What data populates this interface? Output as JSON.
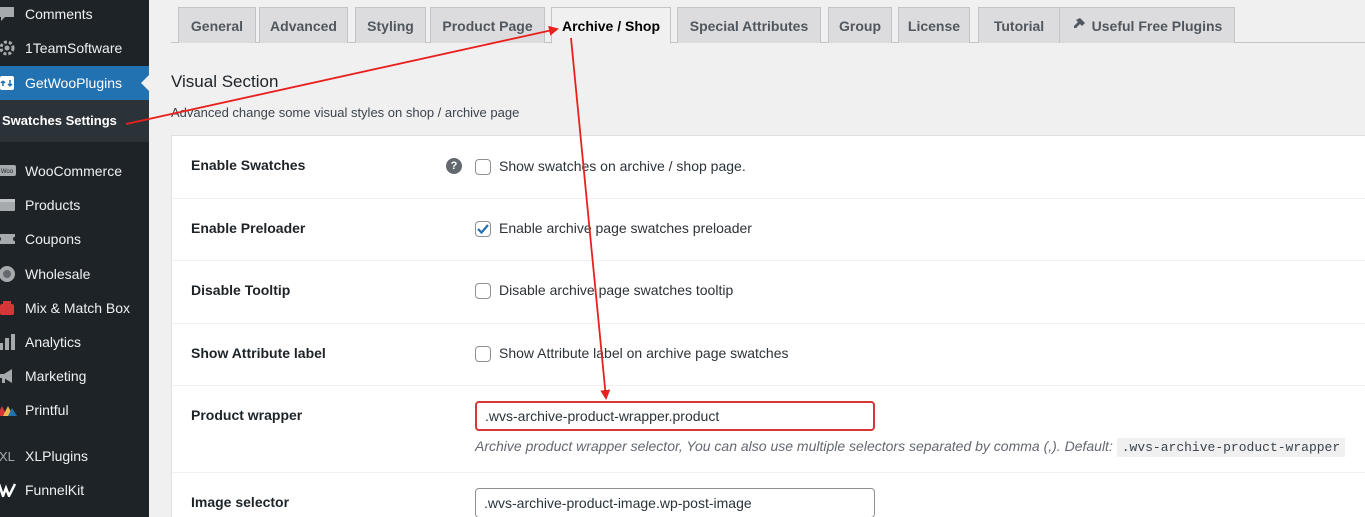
{
  "sidebar": {
    "items": [
      {
        "label": "Comments",
        "icon": "comments-icon"
      },
      {
        "label": "1TeamSoftware",
        "icon": "gear-icon"
      },
      {
        "label": "GetWooPlugins",
        "icon": "plugin-icon"
      },
      {
        "label": "WooCommerce",
        "icon": "woo-icon"
      },
      {
        "label": "Products",
        "icon": "products-icon"
      },
      {
        "label": "Coupons",
        "icon": "coupon-icon"
      },
      {
        "label": "Wholesale",
        "icon": "wholesale-icon"
      },
      {
        "label": "Mix & Match Box",
        "icon": "box-icon"
      },
      {
        "label": "Analytics",
        "icon": "analytics-icon"
      },
      {
        "label": "Marketing",
        "icon": "megaphone-icon"
      },
      {
        "label": "Printful",
        "icon": "printful-icon"
      },
      {
        "label": "XLPlugins",
        "icon": "xl-icon"
      },
      {
        "label": "FunnelKit",
        "icon": "funnelkit-icon"
      }
    ],
    "submenu_label": "Swatches Settings"
  },
  "tabs": [
    {
      "label": "General"
    },
    {
      "label": "Advanced"
    },
    {
      "label": "Styling"
    },
    {
      "label": "Product Page"
    },
    {
      "label": "Archive / Shop"
    },
    {
      "label": "Special Attributes"
    },
    {
      "label": "Group"
    },
    {
      "label": "License"
    },
    {
      "label": "Tutorial"
    },
    {
      "label": "Useful Free Plugins"
    }
  ],
  "section": {
    "title": "Visual Section",
    "description": "Advanced change some visual styles on shop / archive page"
  },
  "rows": {
    "enable_swatches": {
      "label": "Enable Swatches",
      "help": "?",
      "checkbox_label": "Show swatches on archive / shop page.",
      "checked": false
    },
    "enable_preloader": {
      "label": "Enable Preloader",
      "checkbox_label": "Enable archive page swatches preloader",
      "checked": true
    },
    "disable_tooltip": {
      "label": "Disable Tooltip",
      "checkbox_label": "Disable archive page swatches tooltip",
      "checked": false
    },
    "show_attribute_label": {
      "label": "Show Attribute label",
      "checkbox_label": "Show Attribute label on archive page swatches",
      "checked": false
    },
    "product_wrapper": {
      "label": "Product wrapper",
      "value": ".wvs-archive-product-wrapper.product",
      "description": "Archive product wrapper selector, You can also use multiple selectors separated by comma (,). Default:",
      "default_code": ".wvs-archive-product-wrapper"
    },
    "image_selector": {
      "label": "Image selector",
      "value": ".wvs-archive-product-image.wp-post-image"
    }
  },
  "colors": {
    "accent": "#2271b1",
    "sidebar": "#1d2327",
    "annotation": "#e8211d"
  }
}
